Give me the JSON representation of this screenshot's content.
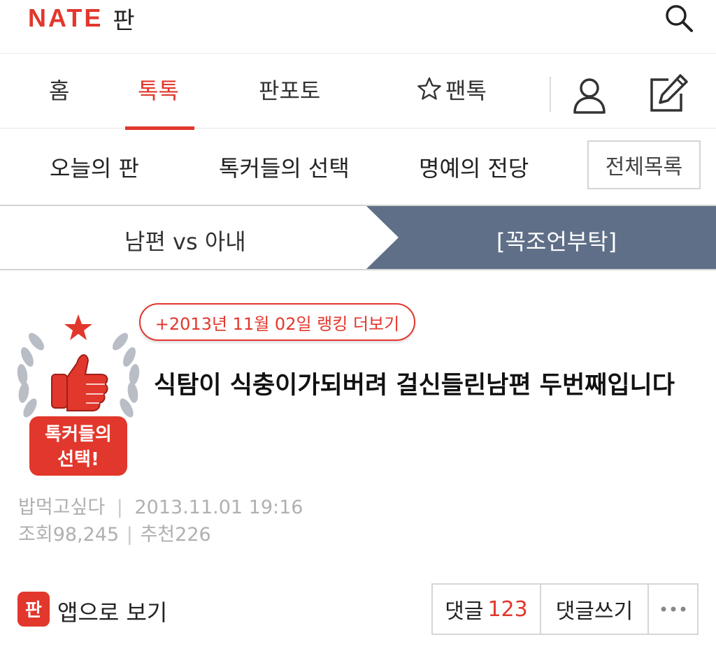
{
  "header": {
    "logo_nate": "NATE",
    "logo_pan": "판",
    "search_icon": "search-icon"
  },
  "nav": {
    "tabs": [
      {
        "label": "홈"
      },
      {
        "label": "톡톡",
        "active": true
      },
      {
        "label": "판포토"
      },
      {
        "label": "팬톡",
        "icon": "star-icon"
      }
    ],
    "user_icon": "user-icon",
    "write_icon": "edit-icon"
  },
  "subnav": {
    "items": [
      "오늘의 판",
      "톡커들의 선택",
      "명예의 전당"
    ],
    "all_button": "전체목록"
  },
  "breadcrumb": {
    "left": "남편 vs 아내",
    "right": "[꼭조언부탁]"
  },
  "post": {
    "badge_text_line1": "톡커들의",
    "badge_text_line2": "선택!",
    "rank_link": "+2013년 11월 02일 랭킹 더보기",
    "title": "식탐이 식충이가되버려 걸신들린남편 두번째입니다",
    "author": "밥먹고싶다",
    "date": "2013.11.01 19:16",
    "views_label": "조회",
    "views": "98,245",
    "recommend_label": "추천",
    "recommend": "226"
  },
  "actions": {
    "app_label": "앱으로 보기",
    "comments_label": "댓글",
    "comments_count": "123",
    "write_comment": "댓글쓰기",
    "more": "···"
  },
  "colors": {
    "accent": "#e2372c",
    "breadcrumb_bg": "#5f6f88",
    "muted": "#b0b0b0"
  }
}
